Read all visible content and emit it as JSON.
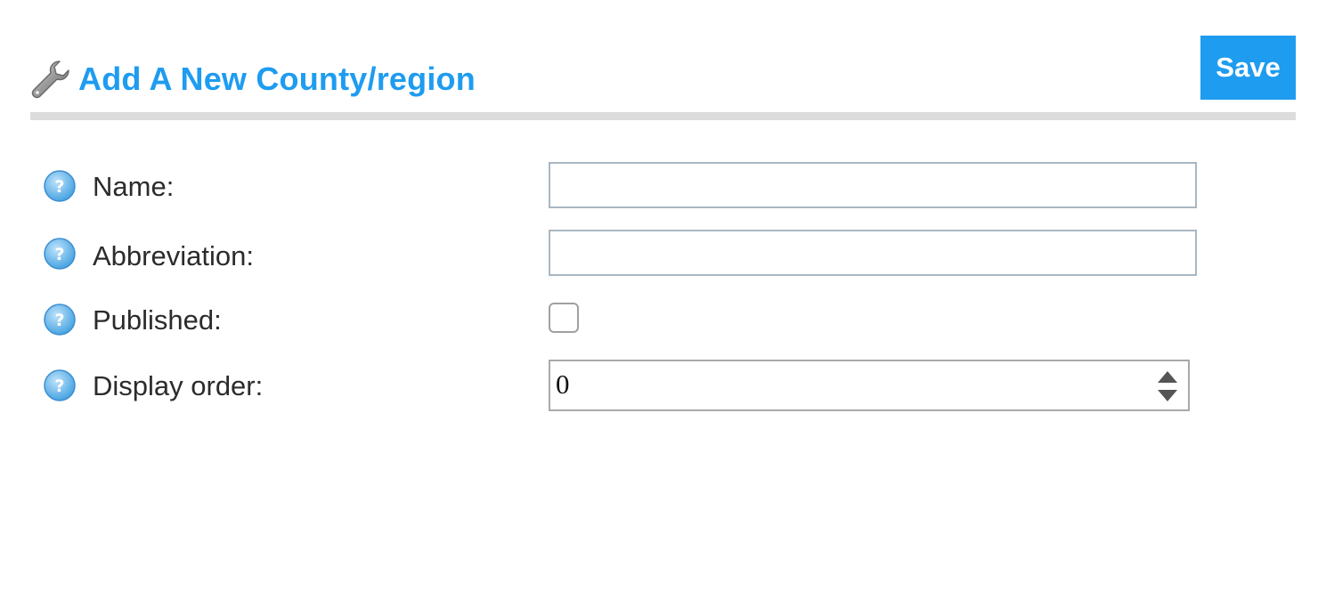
{
  "header": {
    "title": "Add A New County/region",
    "save_label": "Save"
  },
  "form": {
    "fields": [
      {
        "label": "Name:",
        "type": "text",
        "value": ""
      },
      {
        "label": "Abbreviation:",
        "type": "text",
        "value": ""
      },
      {
        "label": "Published:",
        "type": "checkbox",
        "checked": false
      },
      {
        "label": "Display order:",
        "type": "number",
        "value": "0"
      }
    ]
  },
  "icons": {
    "title_icon": "wrench-icon",
    "help_icon": "help-icon",
    "spinner_icon": "spinner-arrows-icon"
  },
  "colors": {
    "accent": "#1e9cf0",
    "divider": "#dcdcdc",
    "help_icon": "#58aee8",
    "input_border": "#a9b7c2"
  }
}
